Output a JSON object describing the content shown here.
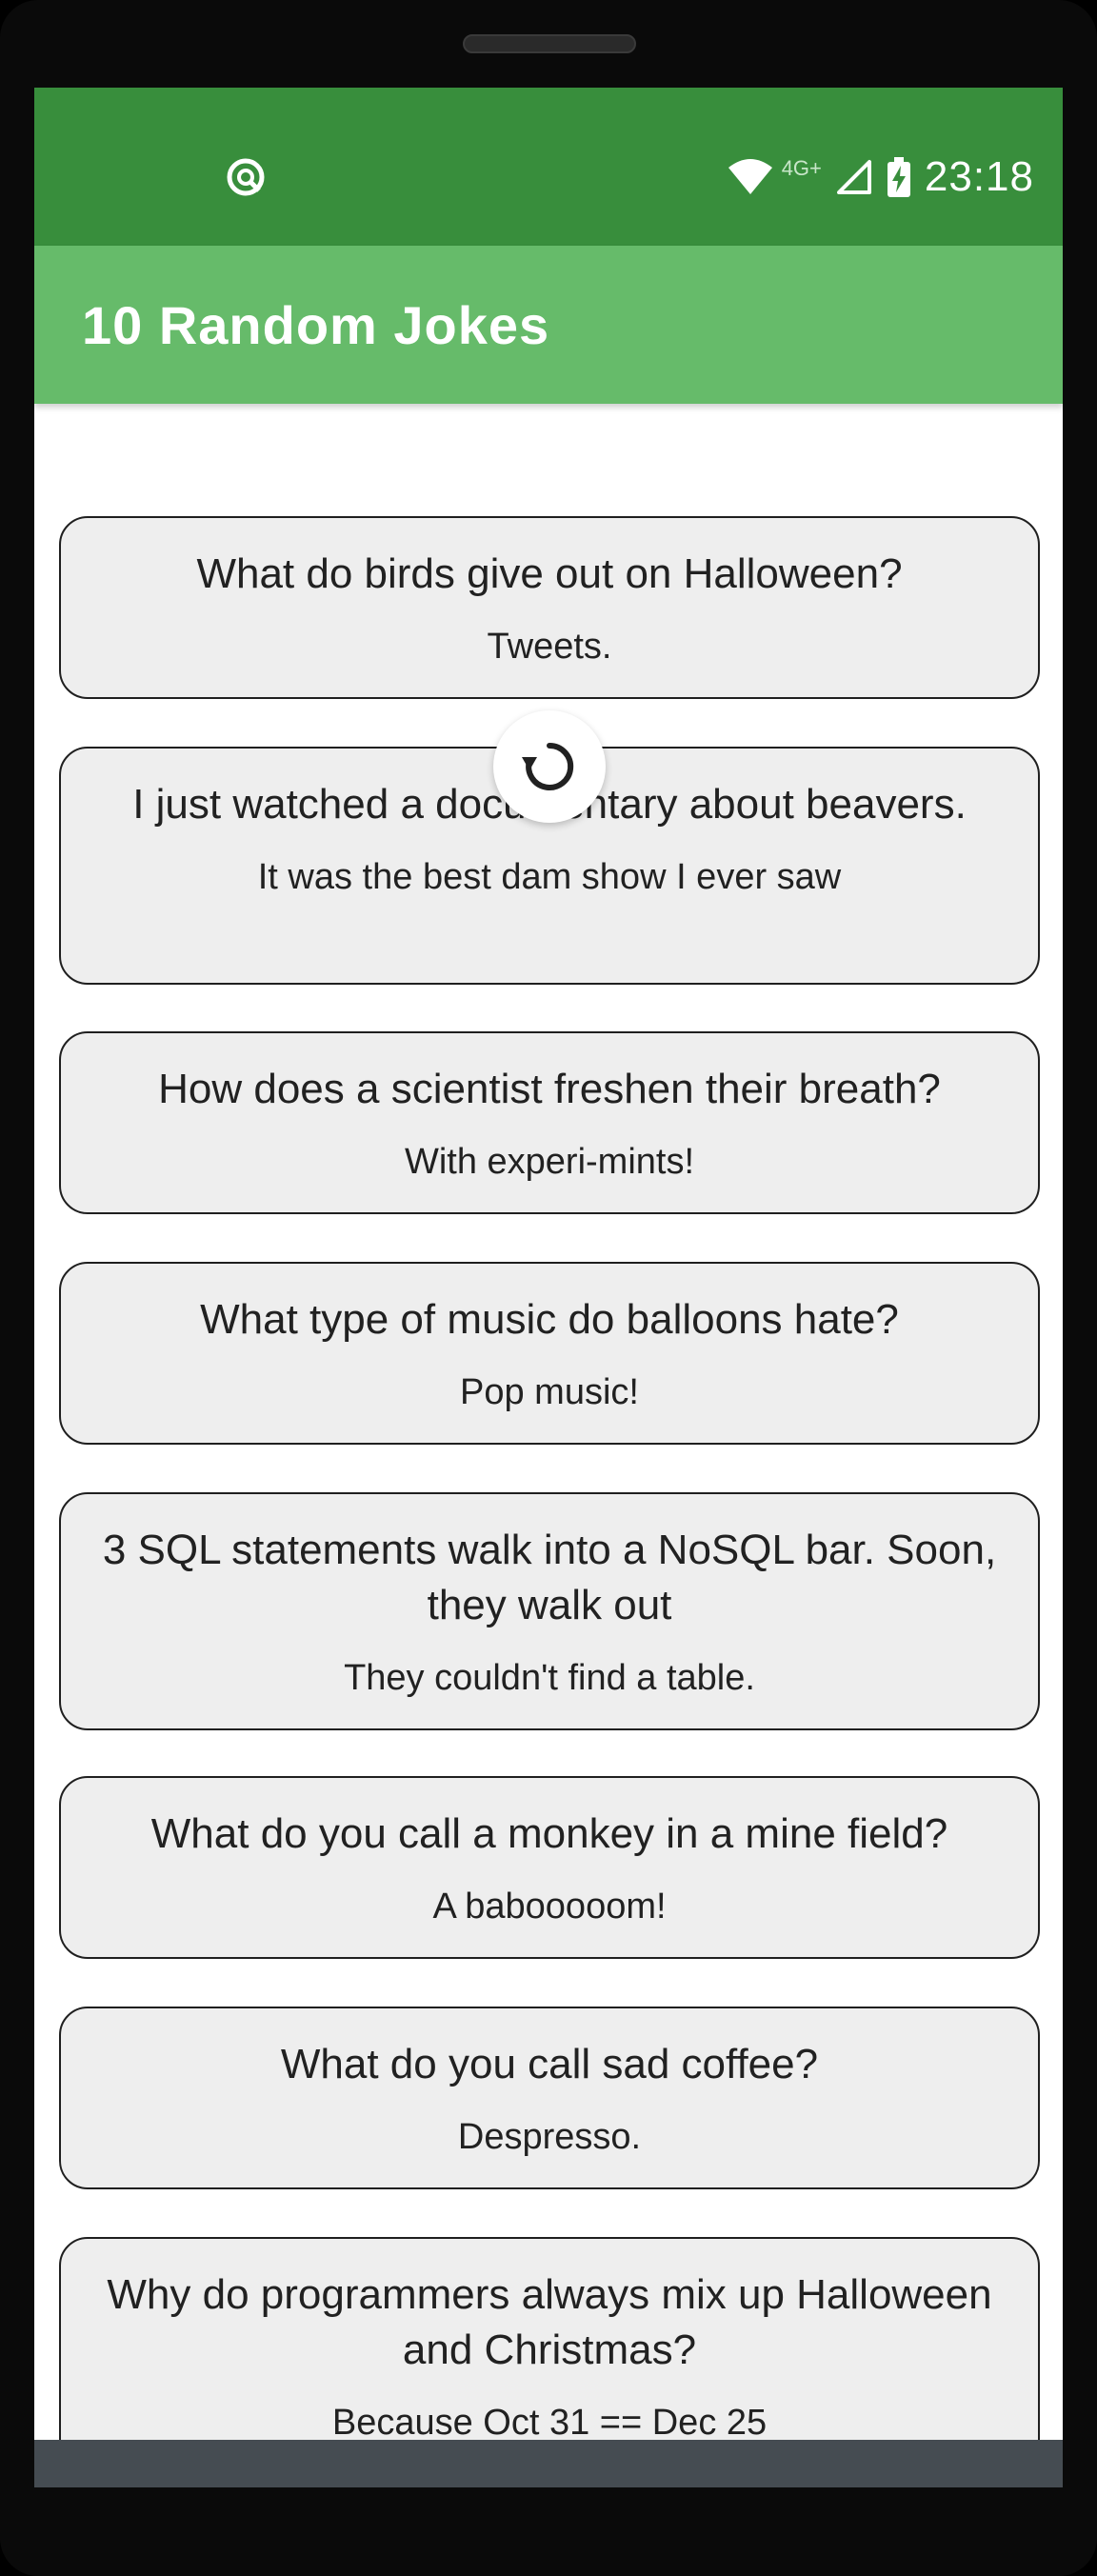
{
  "status_bar": {
    "time": "23:18",
    "network_label": "4G+",
    "icons": [
      "app-notification-icon",
      "wifi-icon",
      "cell-signal-icon",
      "battery-charging-icon"
    ]
  },
  "app_bar": {
    "title": "10 Random Jokes"
  },
  "colors": {
    "status_bar": "#388e3c",
    "app_bar": "#66bb6a",
    "card_background": "#eeeeee",
    "nav_bar": "#454c52"
  },
  "refresh_button": {
    "icon": "refresh-icon"
  },
  "jokes": [
    {
      "setup": "What do birds give out on Halloween?",
      "punchline": "Tweets."
    },
    {
      "setup": "I just watched a documentary about beavers.",
      "punchline": "It was the best dam show I ever saw"
    },
    {
      "setup": "How does a scientist freshen their breath?",
      "punchline": "With experi-mints!"
    },
    {
      "setup": "What type of music do balloons hate?",
      "punchline": "Pop music!"
    },
    {
      "setup": "3 SQL statements walk into a NoSQL bar. Soon, they walk out",
      "punchline": "They couldn't find a table."
    },
    {
      "setup": "What do you call a monkey in a mine field?",
      "punchline": "A babooooom!"
    },
    {
      "setup": "What do you call sad coffee?",
      "punchline": "Despresso."
    },
    {
      "setup": "Why do programmers always mix up Halloween and Christmas?",
      "punchline": "Because Oct 31 == Dec 25"
    }
  ],
  "nav_bar": {
    "icons": [
      "back-icon",
      "home-pill-icon"
    ]
  }
}
